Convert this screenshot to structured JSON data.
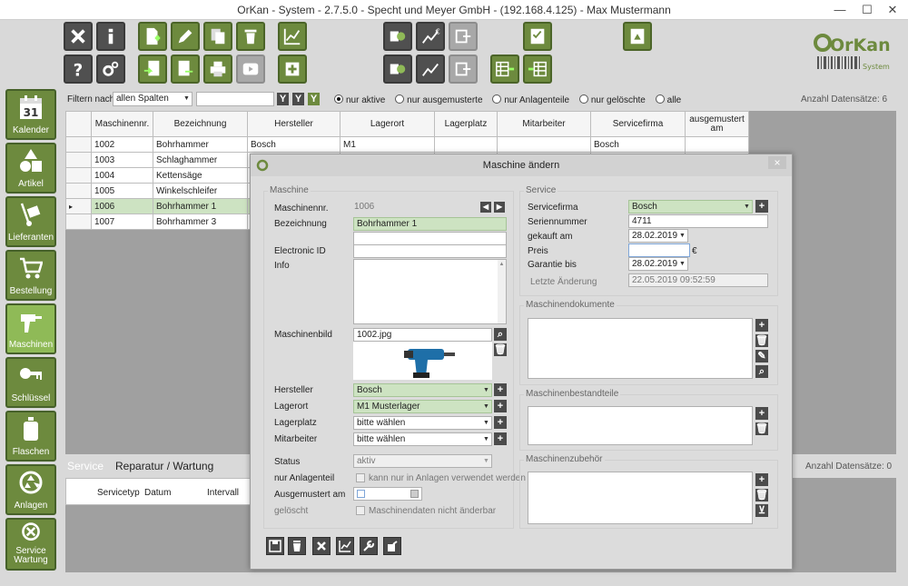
{
  "window": {
    "title": "OrKan - System - 2.7.5.0 - Specht und Meyer GmbH  - (192.168.4.125) - Max Mustermann"
  },
  "logo": {
    "text": "OrKan",
    "sub": "System"
  },
  "filter": {
    "label": "Filtern nach",
    "select_value": "allen Spalten",
    "search_value": "",
    "radios": [
      "nur aktive",
      "nur ausgemusterte",
      "nur Anlagenteile",
      "nur gelöschte",
      "alle"
    ],
    "selected": 0,
    "count": "Anzahl Datensätze: 6"
  },
  "sidebar": [
    {
      "label": "Kalender",
      "icon": "calendar-icon"
    },
    {
      "label": "Artikel",
      "icon": "shapes-icon"
    },
    {
      "label": "Lieferanten",
      "icon": "hand-truck-icon"
    },
    {
      "label": "Bestellung",
      "icon": "cart-icon"
    },
    {
      "label": "Maschinen",
      "icon": "drill-icon"
    },
    {
      "label": "Schlüssel",
      "icon": "key-icon"
    },
    {
      "label": "Flaschen",
      "icon": "bottle-icon"
    },
    {
      "label": "Anlagen",
      "icon": "recycle-icon"
    },
    {
      "label": "Service Wartung",
      "icon": "gears-icon"
    }
  ],
  "calendar_day": "31",
  "grid": {
    "columns": [
      "Maschinennr.",
      "Bezeichnung",
      "Hersteller",
      "Lagerort",
      "Lagerplatz",
      "Mitarbeiter",
      "Servicefirma",
      "ausgemustert am"
    ],
    "rows": [
      [
        "1002",
        "Bohrhammer",
        "Bosch",
        "M1",
        "",
        "",
        "Bosch",
        ""
      ],
      [
        "1003",
        "Schlaghammer",
        "",
        "",
        "",
        "",
        "",
        ""
      ],
      [
        "1004",
        "Kettensäge",
        "",
        "",
        "",
        "",
        "",
        ""
      ],
      [
        "1005",
        "Winkelschleifer",
        "",
        "",
        "",
        "",
        "",
        ""
      ],
      [
        "1006",
        "Bohrhammer 1",
        "",
        "",
        "",
        "",
        "",
        ""
      ],
      [
        "1007",
        "Bohrhammer 3",
        "",
        "",
        "",
        "",
        "",
        ""
      ]
    ],
    "selected": 4,
    "row_marker": "▸"
  },
  "service_tabs": {
    "tab1": "Service",
    "tab2": "Reparatur / Wartung",
    "count": "Anzahl Datensätze: 0",
    "columns": [
      "Servicetyp",
      "Datum",
      "Intervall"
    ]
  },
  "dialog": {
    "title": "Maschine ändern",
    "close": "×",
    "maschine": {
      "group": "Maschine",
      "nr_label": "Maschinennr.",
      "nr": "1006",
      "bez_label": "Bezeichnung",
      "bez": "Bohrhammer 1",
      "eid_label": "Electronic ID",
      "eid": "",
      "info_label": "Info",
      "bild_label": "Maschinenbild",
      "bild": "1002.jpg",
      "hersteller_label": "Hersteller",
      "hersteller": "Bosch",
      "lagerort_label": "Lagerort",
      "lagerort": "M1 Musterlager",
      "lagerplatz_label": "Lagerplatz",
      "lagerplatz": "bitte wählen",
      "mitarbeiter_label": "Mitarbeiter",
      "mitarbeiter": "bitte wählen",
      "status_label": "Status",
      "status": "aktiv",
      "anlagenteil_label": "nur Anlagenteil",
      "anlagenteil_check": "kann nur in Anlagen verwendet werden",
      "ausgemustert_label": "Ausgemustert am",
      "geloescht_label": "gelöscht",
      "geloescht_check": "Maschinendaten nicht änderbar"
    },
    "service": {
      "group": "Service",
      "firma_label": "Servicefirma",
      "firma": "Bosch",
      "sn_label": "Seriennummer",
      "sn": "4711",
      "gekauft_label": "gekauft am",
      "gekauft": "28.02.2019",
      "preis_label": "Preis",
      "preis": "",
      "currency": "€",
      "garantie_label": "Garantie bis",
      "garantie": "28.02.2019",
      "aenderung_label": "Letzte Änderung",
      "aenderung": "22.05.2019 09:52:59"
    },
    "docs": {
      "group": "Maschinendokumente"
    },
    "parts": {
      "group": "Maschinenbestandteile"
    },
    "acc": {
      "group": "Maschinenzubehör"
    }
  },
  "colors": {
    "green": "#6d8a3e",
    "active": "#8fba57",
    "dark": "#4b4b4b",
    "selected_row": "#cde3c2"
  }
}
